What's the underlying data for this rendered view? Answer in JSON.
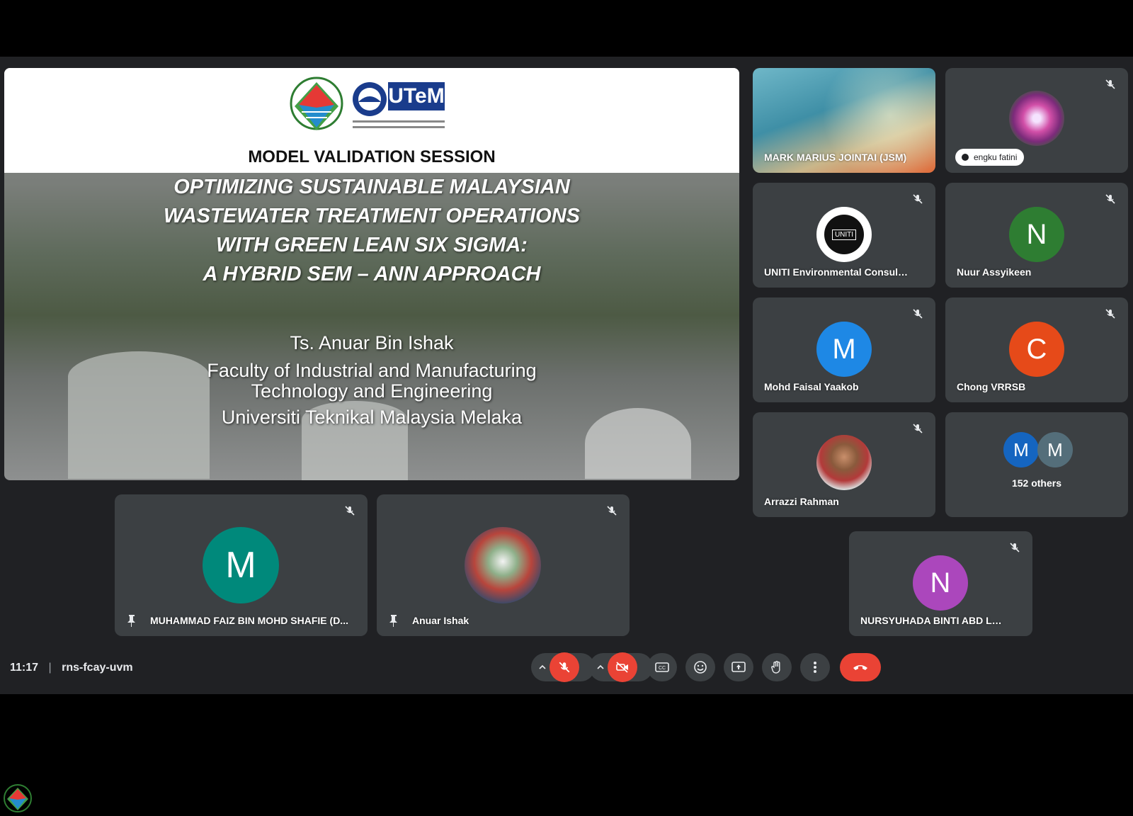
{
  "slide": {
    "logo_text": "UTeM",
    "session_title": "MODEL VALIDATION SESSION",
    "headline_lines": [
      "OPTIMIZING SUSTAINABLE MALAYSIAN",
      "WASTEWATER TREATMENT OPERATIONS",
      "WITH GREEN LEAN SIX SIGMA:",
      "A HYBRID SEM – ANN APPROACH"
    ],
    "presenter_lines": [
      "Ts. Anuar Bin Ishak",
      "Faculty of Industrial and Manufacturing",
      "Technology and Engineering",
      "Universiti Teknikal Malaysia Melaka"
    ]
  },
  "participants": {
    "mark": {
      "name": "MARK MARIUS JOINTAI (JSM)"
    },
    "engku": {
      "name": "engku fatini"
    },
    "uniti": {
      "name": "UNITI Environmental Consulta...",
      "avatar_text": "UNITI"
    },
    "nuur": {
      "name": "Nuur Assyikeen",
      "initial": "N",
      "color": "#2e7d32"
    },
    "mohd": {
      "name": "Mohd Faisal Yaakob",
      "initial": "M",
      "color": "#1e88e5"
    },
    "chong": {
      "name": "Chong VRRSB",
      "initial": "C",
      "color": "#e64a19"
    },
    "arrazzi": {
      "name": "Arrazzi Rahman"
    },
    "others": {
      "label": "152 others",
      "initial_a": "M",
      "initial_b": "M",
      "color_a": "#1565c0",
      "color_b": "#546e7a"
    },
    "muhammad": {
      "name": "MUHAMMAD FAIZ BIN MOHD SHAFIE (D...",
      "initial": "M",
      "color": "#00897b"
    },
    "anuar": {
      "name": "Anuar Ishak"
    },
    "nursyuhada": {
      "name": "NURSYUHADA BINTI ABD LAH ...",
      "initial": "N",
      "color": "#ab47bc"
    }
  },
  "bottombar": {
    "time": "11:17",
    "separator": "|",
    "meeting_code": "rns-fcay-uvm"
  },
  "colors": {
    "meet_bg": "#202124",
    "tile_bg": "#3c4043",
    "danger": "#ea4335"
  }
}
